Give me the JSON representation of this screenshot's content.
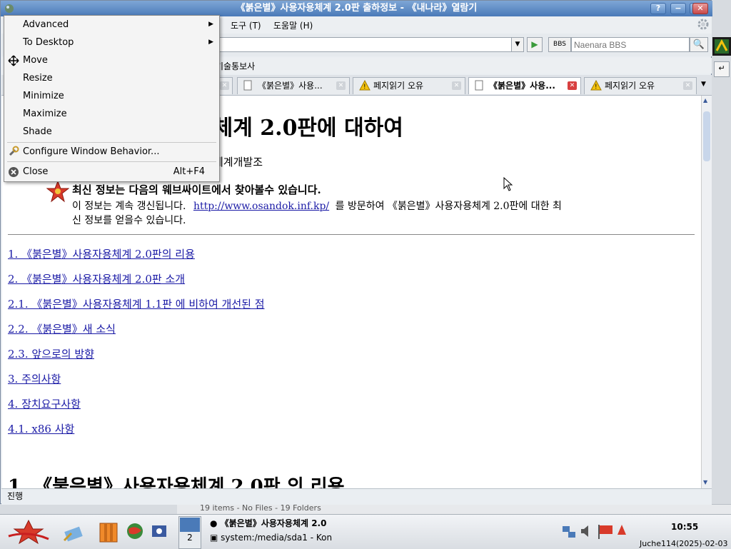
{
  "window": {
    "title": "《붉은별》사용자용체계 2.0판 출하정보 - 《내나라》열람기",
    "buttons": {
      "help": "?",
      "minimize": "−",
      "maximize": "□",
      "close": "✕"
    }
  },
  "menubar": {
    "items": [
      "도구 (T)",
      "도움말 (H)"
    ]
  },
  "navbar": {
    "url_value": "",
    "search_engine": "BBS",
    "search_placeholder": "Naenara BBS"
  },
  "bookmarks": {
    "visible": "기술통보사"
  },
  "tabs": [
    {
      "label": "",
      "active": false
    },
    {
      "label": "《붉은별》사용...",
      "active": false
    },
    {
      "label": "페지읽기 오유",
      "active": false
    },
    {
      "label": "《붉은별》사용...",
      "active": true
    },
    {
      "label": "페지읽기 오유",
      "active": false
    }
  ],
  "page": {
    "heading": "용체계 2.0판에 대하여",
    "sub_partial": "체계개발조",
    "notice_title": "최신 정보는 다음의 웨브싸이트에서 찾아볼수 있습니다.",
    "notice_pre": "이 정보는 계속 갱신됩니다.",
    "notice_link": "http://www.osandok.inf.kp/",
    "notice_post": "를 방문하여 《붉은별》사용자용체계 2.0판에 대한 최",
    "notice_line2": "신 정보를 얻을수 있습니다.",
    "toc": [
      "1. 《붉은별》사용자용체계 2.0판의 리용",
      "2. 《붉은별》사용자용체계 2.0판 소개",
      "2.1. 《붉은별》사용자용체계 1.1판 에 비하여 개선된 점",
      "2.2. 《붉은별》새 소식",
      "2.3. 앞으로의 방향",
      "3. 주의사항",
      "4. 장치요구사항",
      "4.1. x86 사항"
    ],
    "section_heading": "1. 《붉은별》사용자용체계 2.0판 의 리용"
  },
  "status": {
    "text": "진행"
  },
  "context_menu": {
    "items": [
      {
        "label": "Advanced",
        "submenu": true
      },
      {
        "label": "To Desktop",
        "submenu": true
      },
      {
        "label": "Move",
        "icon": "move-icon"
      },
      {
        "label": "Resize"
      },
      {
        "label": "Minimize"
      },
      {
        "label": "Maximize"
      },
      {
        "label": "Shade"
      },
      {
        "label": "Configure Window Behavior...",
        "icon": "wrench-icon"
      },
      {
        "label": "Close",
        "shortcut": "Alt+F4",
        "icon": "close-icon"
      }
    ]
  },
  "behind_window": {
    "status": "19 items - No Files - 19 Folders"
  },
  "taskbar": {
    "desktop_number": "2",
    "tasks": [
      "《붉은별》사용자용체계 2.0",
      "system:/media/sda1 - Kon"
    ],
    "clock": "10:55",
    "date": "Juche114(2025)-02-03"
  },
  "colors": {
    "accent": "#4a7ab8",
    "link": "#1a1aa6",
    "close_red": "#d84040"
  }
}
